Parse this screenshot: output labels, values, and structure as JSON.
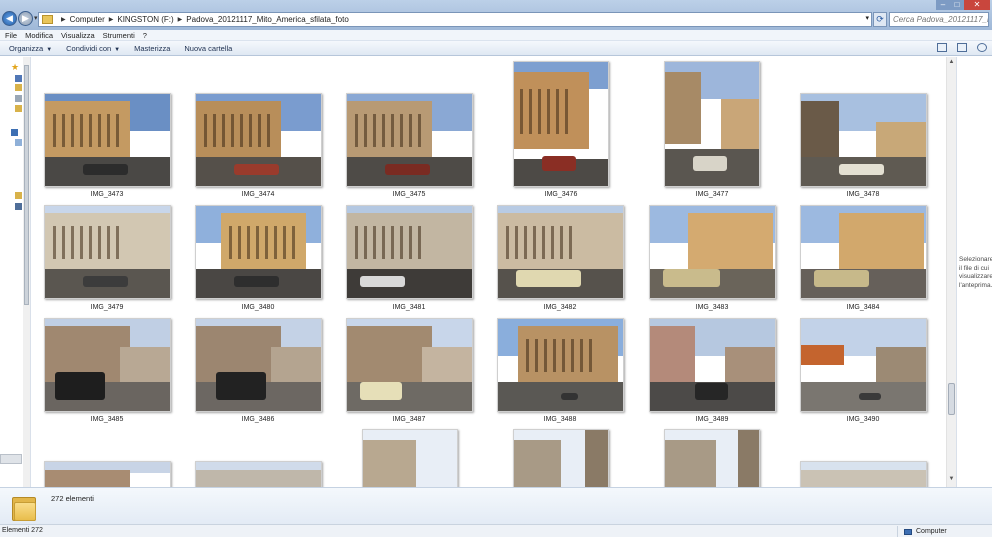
{
  "address": {
    "crumbs": [
      "Computer",
      "KINGSTON (F:)",
      "Padova_20121117_Mito_America_sfilata_foto"
    ]
  },
  "search": {
    "placeholder": "Cerca Padova_20121117_Mito..."
  },
  "menu": [
    "File",
    "Modifica",
    "Visualizza",
    "Strumenti",
    "?"
  ],
  "toolbar": {
    "organize": "Organizza",
    "share": "Condividi con",
    "burn": "Masterizza",
    "new_folder": "Nuova cartella"
  },
  "files": [
    {
      "name": "IMG_3473"
    },
    {
      "name": "IMG_3474"
    },
    {
      "name": "IMG_3475"
    },
    {
      "name": "IMG_3476"
    },
    {
      "name": "IMG_3477"
    },
    {
      "name": "IMG_3478"
    },
    {
      "name": "IMG_3479"
    },
    {
      "name": "IMG_3480"
    },
    {
      "name": "IMG_3481"
    },
    {
      "name": "IMG_3482"
    },
    {
      "name": "IMG_3483"
    },
    {
      "name": "IMG_3484"
    },
    {
      "name": "IMG_3485"
    },
    {
      "name": "IMG_3486"
    },
    {
      "name": "IMG_3487"
    },
    {
      "name": "IMG_3488"
    },
    {
      "name": "IMG_3489"
    },
    {
      "name": "IMG_3490"
    }
  ],
  "preview": {
    "message": "Selezionare il file di cui visualizzare l'anteprima."
  },
  "details": {
    "count": "272 elementi"
  },
  "status": {
    "left": "Elementi 272",
    "location": "Computer"
  },
  "colors": {
    "accent": "#3d6fb3",
    "titlebar": "#bcd0e8"
  }
}
